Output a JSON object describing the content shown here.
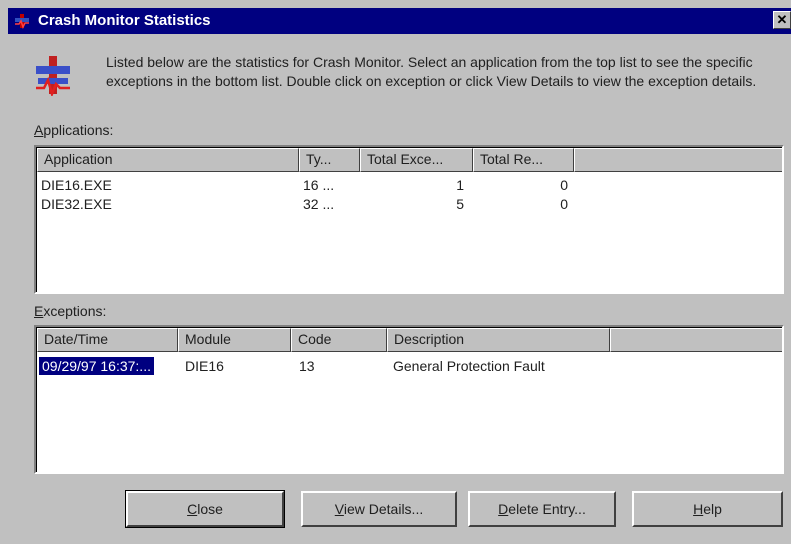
{
  "window": {
    "title": "Crash Monitor Statistics",
    "close_glyph": "✕"
  },
  "intro": {
    "text": "Listed below are the statistics for Crash Monitor.  Select an application from the top list to see the specific exceptions in the bottom list.  Double click on exception or click View Details to view the exception details."
  },
  "applications": {
    "label_mnemonic": "A",
    "label_rest": "pplications:",
    "columns": [
      "Application",
      "Ty...",
      "Total Exce...",
      "Total Re..."
    ],
    "rows": [
      {
        "application": "DIE16.EXE",
        "type": "16 ...",
        "total_exceptions": "1",
        "total_restarts": "0"
      },
      {
        "application": "DIE32.EXE",
        "type": "32 ...",
        "total_exceptions": "5",
        "total_restarts": "0"
      }
    ]
  },
  "exceptions": {
    "label_mnemonic": "E",
    "label_rest": "xceptions:",
    "columns": [
      "Date/Time",
      "Module",
      "Code",
      "Description"
    ],
    "rows": [
      {
        "datetime": "09/29/97 16:37:...",
        "module": "DIE16",
        "code": "13",
        "description": "General Protection Fault"
      }
    ]
  },
  "buttons": {
    "close": {
      "mnemonic": "C",
      "rest": "lose"
    },
    "view_details": {
      "mnemonic": "V",
      "rest": "iew Details..."
    },
    "delete_entry": {
      "mnemonic": "D",
      "rest": "elete Entry..."
    },
    "help": {
      "mnemonic": "H",
      "rest": "elp"
    }
  },
  "colors": {
    "titlebar": "#000080",
    "selection": "#000080",
    "face": "#c0c0c0"
  }
}
